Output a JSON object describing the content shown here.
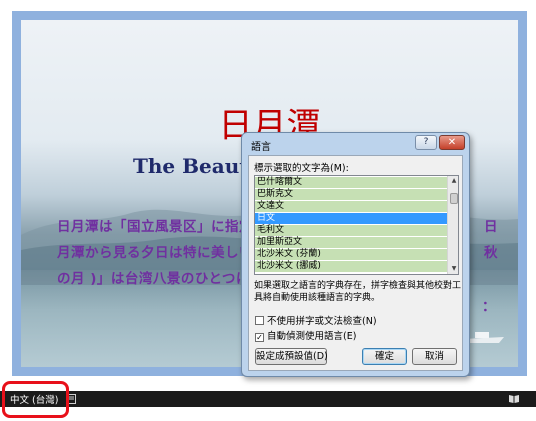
{
  "slide": {
    "title": "日月潭",
    "subtitle": "The Beauty o",
    "body": [
      "日月潭は「国立風景区」に指定さ",
      "月潭から見る夕日は特に美しいと",
      "の月 )」は台湾八景のひとつに数え"
    ],
    "fragments": {
      "right1": "日",
      "right2": "秋",
      "right3": "："
    }
  },
  "status_bar": {
    "language": "中文 (台灣)",
    "doc_icon": "document-check-icon",
    "reading_view_icon": "book-icon"
  },
  "dialog": {
    "title": "語言",
    "help_label": "?",
    "close_label": "✕",
    "mark_label": "標示選取的文字為(M):",
    "languages": [
      "巴什喀爾文",
      "巴斯克文",
      "文達文",
      "日文",
      "毛利文",
      "加里斯亞文",
      "北沙米文 (芬蘭)",
      "北沙米文 (挪威)"
    ],
    "selected_language": "日文",
    "description": "如果選取之語言的字典存在，拼字檢查與其他校對工具將自動使用該種語言的字典。",
    "no_proofing_label": "不使用拼字或文法檢查(N)",
    "no_proofing_checked": false,
    "detect_language_label": "自動偵測使用語言(E)",
    "detect_language_checked": true,
    "set_default_label": "設定成預設值(D)",
    "ok_label": "確定",
    "cancel_label": "取消"
  },
  "colors": {
    "title_red": "#c00000",
    "subtitle_navy": "#1f2a6b",
    "body_purple": "#7030a0",
    "list_highlight_green": "#c6e0b4",
    "selection_blue": "#3399ff",
    "annotation_red": "#e8101a"
  }
}
